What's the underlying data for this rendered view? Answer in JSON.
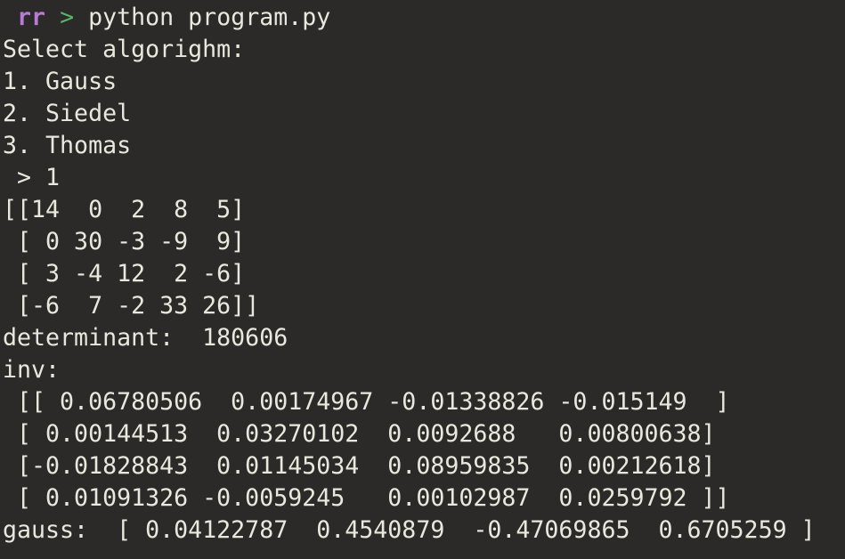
{
  "prompt": {
    "user": "rr",
    "arrow": ">",
    "command": "python program.py"
  },
  "output_lines": [
    "Select algorighm:",
    "1. Gauss",
    "2. Siedel",
    "3. Thomas",
    " > 1",
    "[[14  0  2  8  5]",
    " [ 0 30 -3 -9  9]",
    " [ 3 -4 12  2 -6]",
    " [-6  7 -2 33 26]]",
    "determinant:  180606",
    "inv:",
    " [[ 0.06780506  0.00174967 -0.01338826 -0.015149  ]",
    " [ 0.00144513  0.03270102  0.0092688   0.00800638]",
    " [-0.01828843  0.01145034  0.08959835  0.00212618]",
    " [ 0.01091326 -0.0059245   0.00102987  0.0259792 ]]",
    "gauss:  [ 0.04122787  0.4540879  -0.47069865  0.6705259 ]"
  ],
  "colors": {
    "background": "#2b2a29",
    "foreground": "#eae7dc",
    "prompt_user": "#b77bd6",
    "prompt_arrow": "#58b368"
  }
}
